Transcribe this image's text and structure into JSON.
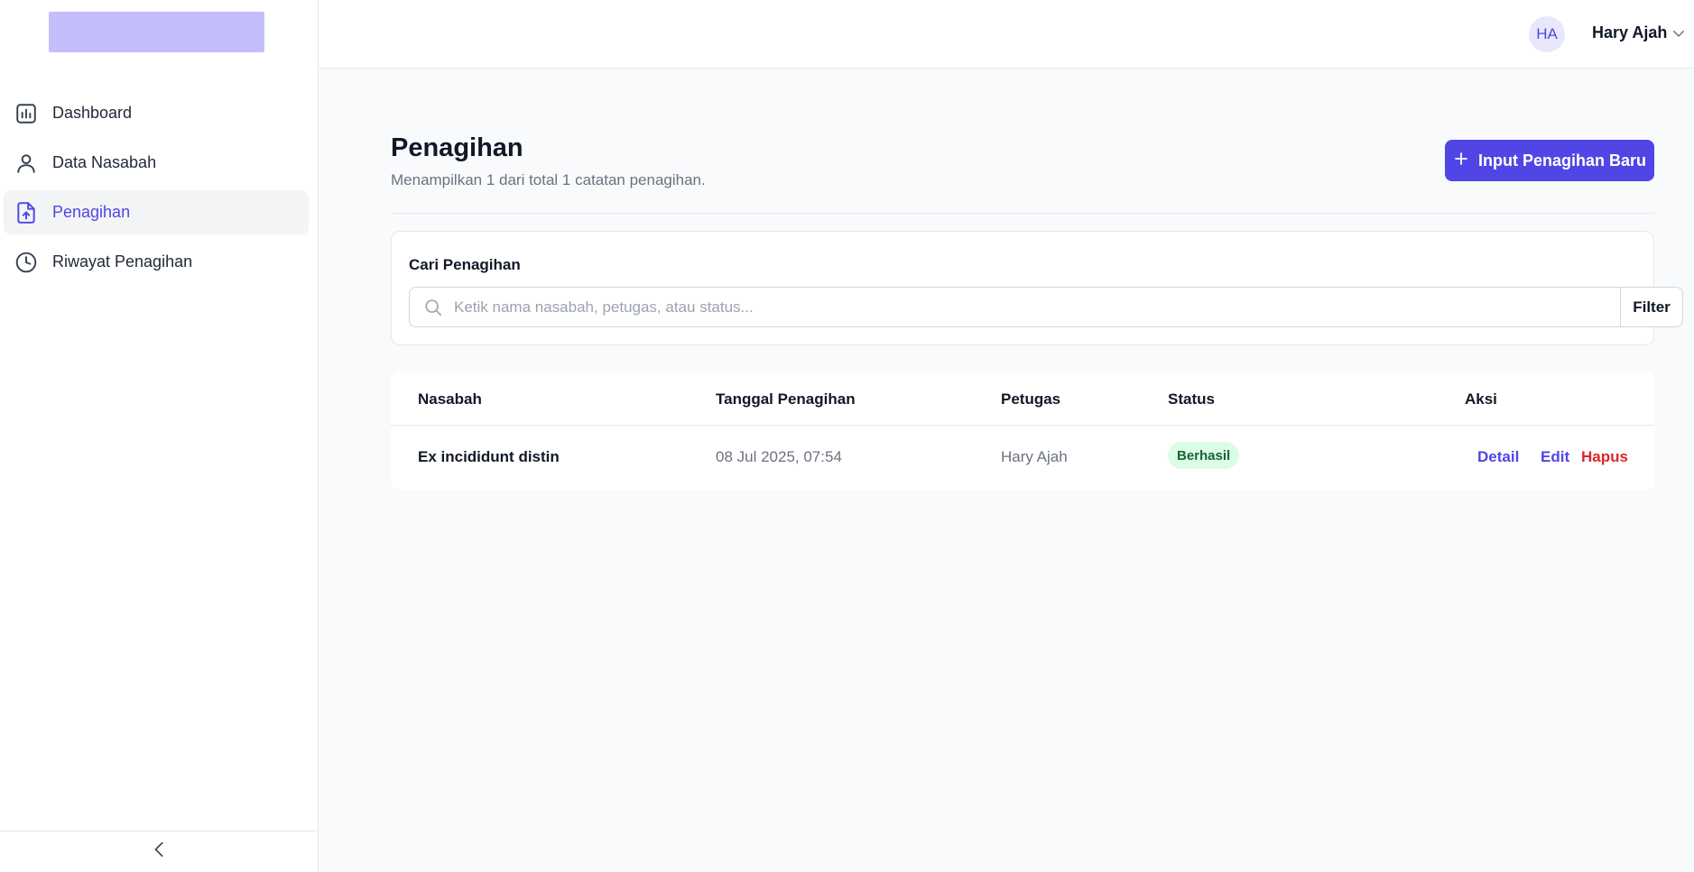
{
  "sidebar": {
    "items": [
      {
        "label": "Dashboard",
        "icon": "chart-bar-icon"
      },
      {
        "label": "Data Nasabah",
        "icon": "user-icon"
      },
      {
        "label": "Penagihan",
        "icon": "document-upload-icon",
        "active": true
      },
      {
        "label": "Riwayat Penagihan",
        "icon": "clock-icon"
      }
    ]
  },
  "header": {
    "avatar_initials": "HA",
    "username": "Hary Ajah"
  },
  "page": {
    "title": "Penagihan",
    "subtitle": "Menampilkan 1 dari total 1 catatan penagihan.",
    "new_button_label": "Input Penagihan Baru"
  },
  "search": {
    "label": "Cari Penagihan",
    "placeholder": "Ketik nama nasabah, petugas, atau status...",
    "value": "",
    "filter_label": "Filter"
  },
  "table": {
    "columns": [
      "Nasabah",
      "Tanggal Penagihan",
      "Petugas",
      "Status",
      "Aksi"
    ],
    "rows": [
      {
        "nasabah": "Ex incididunt distin",
        "tanggal": "08 Jul 2025, 07:54",
        "petugas": "Hary Ajah",
        "status": "Berhasil",
        "actions": {
          "detail": "Detail",
          "edit": "Edit",
          "hapus": "Hapus"
        }
      }
    ]
  },
  "colors": {
    "accent": "#4f46e5",
    "logo_placeholder": "#c4bdfb",
    "success_bg": "#dcfce7",
    "success_text": "#166534",
    "danger": "#dc2626"
  }
}
